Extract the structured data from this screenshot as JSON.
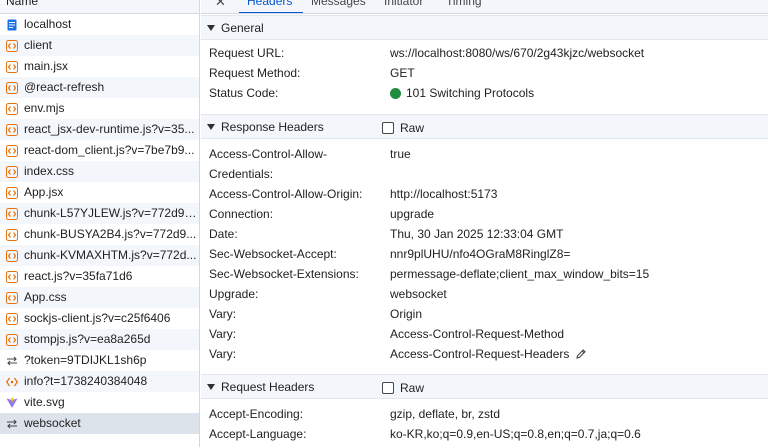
{
  "left": {
    "header": "Name",
    "requests": [
      {
        "label": "localhost",
        "icon": "document-icon"
      },
      {
        "label": "client",
        "icon": "script-icon"
      },
      {
        "label": "main.jsx",
        "icon": "script-icon"
      },
      {
        "label": "@react-refresh",
        "icon": "script-icon"
      },
      {
        "label": "env.mjs",
        "icon": "script-icon"
      },
      {
        "label": "react_jsx-dev-runtime.js?v=35...",
        "icon": "script-icon"
      },
      {
        "label": "react-dom_client.js?v=7be7b9...",
        "icon": "script-icon"
      },
      {
        "label": "index.css",
        "icon": "script-icon"
      },
      {
        "label": "App.jsx",
        "icon": "script-icon"
      },
      {
        "label": "chunk-L57YJLEW.js?v=772d95...",
        "icon": "script-icon"
      },
      {
        "label": "chunk-BUSYA2B4.js?v=772d9...",
        "icon": "script-icon"
      },
      {
        "label": "chunk-KVMAXHTM.js?v=772d...",
        "icon": "script-icon"
      },
      {
        "label": "react.js?v=35fa71d6",
        "icon": "script-icon"
      },
      {
        "label": "App.css",
        "icon": "script-icon"
      },
      {
        "label": "sockjs-client.js?v=c25f6406",
        "icon": "script-icon"
      },
      {
        "label": "stompjs.js?v=ea8a265d",
        "icon": "script-icon"
      },
      {
        "label": "?token=9TDIJKL1sh6p",
        "icon": "websocket-icon"
      },
      {
        "label": "info?t=1738240384048",
        "icon": "fetch-icon"
      },
      {
        "label": "vite.svg",
        "icon": "vite-icon"
      },
      {
        "label": "websocket",
        "icon": "websocket-icon",
        "selected": true
      }
    ]
  },
  "tabs": {
    "close": "✕",
    "items": [
      "Headers",
      "Messages",
      "Initiator",
      "Timing"
    ],
    "active": "Headers"
  },
  "general": {
    "title": "General",
    "rows": [
      {
        "key": "Request URL:",
        "value": "ws://localhost:8080/ws/670/2g43kjzc/websocket"
      },
      {
        "key": "Request Method:",
        "value": "GET"
      },
      {
        "key": "Status Code:",
        "value": "101 Switching Protocols"
      }
    ]
  },
  "response_headers": {
    "title": "Response Headers",
    "raw_label": "Raw",
    "rows": [
      {
        "key": "Access-Control-Allow-",
        "value": "true"
      },
      {
        "key": "Credentials:",
        "value": ""
      },
      {
        "key": "Access-Control-Allow-Origin:",
        "value": "http://localhost:5173"
      },
      {
        "key": "Connection:",
        "value": "upgrade"
      },
      {
        "key": "Date:",
        "value": "Thu, 30 Jan 2025 12:33:04 GMT"
      },
      {
        "key": "Sec-Websocket-Accept:",
        "value": "nnr9plUHU/nfo4OGraM8RinglZ8="
      },
      {
        "key": "Sec-Websocket-Extensions:",
        "value": "permessage-deflate;client_max_window_bits=15"
      },
      {
        "key": "Upgrade:",
        "value": "websocket"
      },
      {
        "key": "Vary:",
        "value": "Origin"
      },
      {
        "key": "Vary:",
        "value": "Access-Control-Request-Method"
      },
      {
        "key": "Vary:",
        "value": "Access-Control-Request-Headers"
      }
    ]
  },
  "request_headers": {
    "title": "Request Headers",
    "raw_label": "Raw",
    "rows": [
      {
        "key": "Accept-Encoding:",
        "value": "gzip, deflate, br, zstd"
      },
      {
        "key": "Accept-Language:",
        "value": "ko-KR,ko;q=0.9,en-US;q=0.8,en;q=0.7,ja;q=0.6"
      }
    ]
  },
  "colors": {
    "accent": "#0b57d0",
    "status_ok": "#1e8e3e",
    "script_icon": "#e8710a",
    "document_icon": "#1a73e8"
  }
}
